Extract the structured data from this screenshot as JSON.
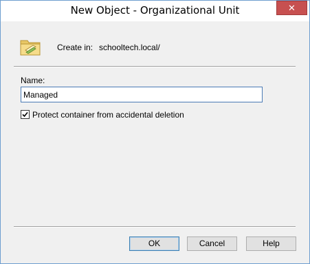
{
  "window": {
    "title": "New Object - Organizational Unit",
    "close_symbol": "✕"
  },
  "header": {
    "icon": "organizational-unit-folder-icon",
    "create_in_label": "Create in:",
    "create_in_value": "schooltech.local/"
  },
  "form": {
    "name_label": "Name:",
    "name_value": "Managed",
    "protect_checkbox": {
      "label": "Protect container from accidental deletion",
      "checked": true
    }
  },
  "buttons": {
    "ok": "OK",
    "cancel": "Cancel",
    "help": "Help"
  },
  "colors": {
    "title_bar": "#ffffff",
    "close_button": "#c75050",
    "dialog_background": "#f0f0f0",
    "input_border": "#4a7ab5"
  }
}
